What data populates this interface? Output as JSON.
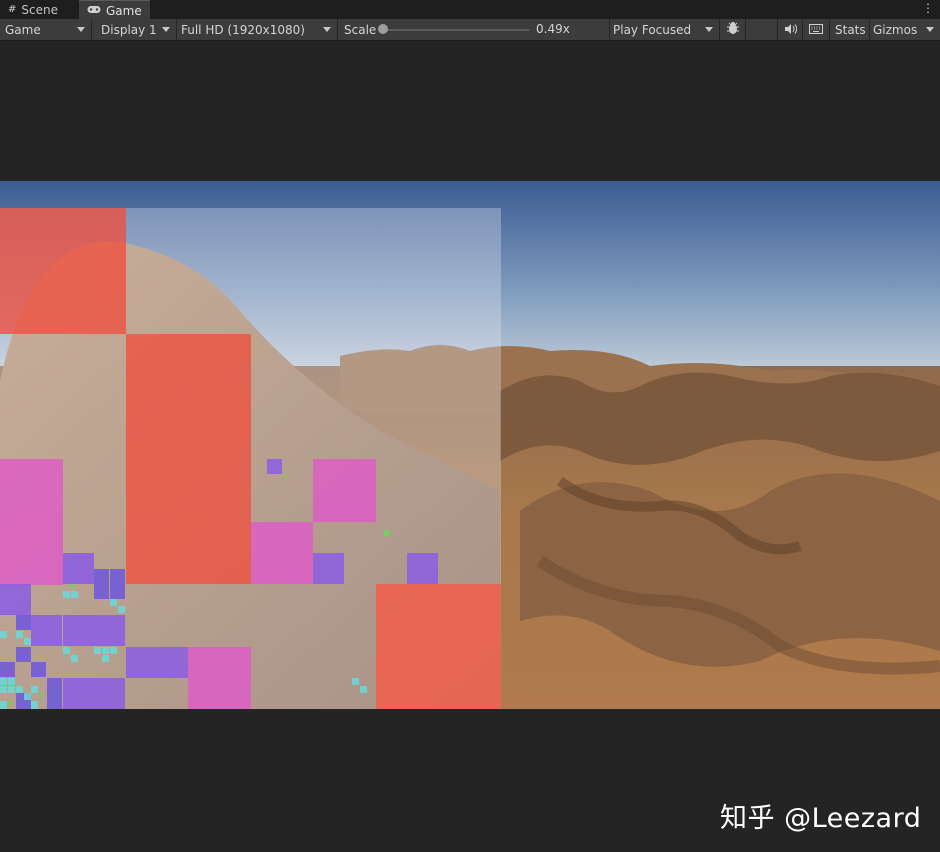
{
  "tabs": [
    {
      "label": "Scene",
      "icon": "grid-icon"
    },
    {
      "label": "Game",
      "icon": "gamepad-icon",
      "active": true
    }
  ],
  "toolbar": {
    "view_select": "Game",
    "display": "Display 1",
    "resolution": "Full HD (1920x1080)",
    "scale_label": "Scale",
    "scale_value": "0.49x",
    "play_mode": "Play Focused",
    "stats": "Stats",
    "gizmos": "Gizmos"
  },
  "watermark": "知乎 @Leezard",
  "colors": {
    "sky_top": "#3d5f96",
    "sky_horizon": "#b8c7d6",
    "sand": "#a8784d",
    "overlay_red": "#f05a4a",
    "overlay_magenta": "#e05ac8",
    "overlay_purple": "#8a5ae8",
    "overlay_cyan": "#6ad8d8",
    "toolbar_bg": "#3c3c3c"
  }
}
